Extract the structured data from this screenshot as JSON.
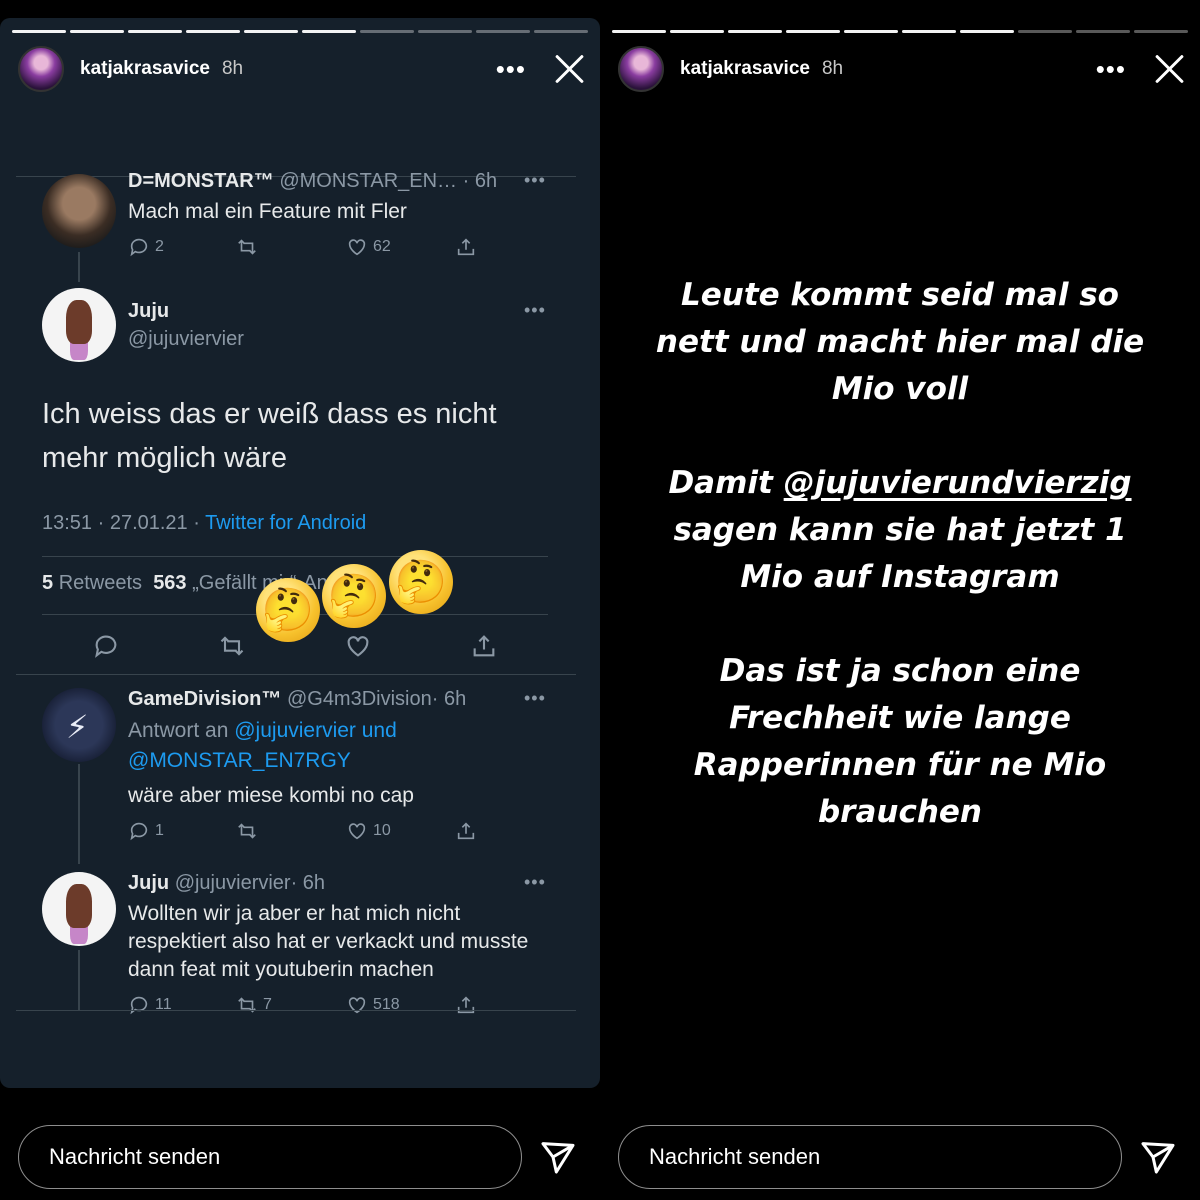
{
  "stories": [
    {
      "username": "katjakrasavice",
      "time": "8h",
      "tweets": {
        "t1": {
          "name": "D=MONSTAR™",
          "handle": "@MONSTAR_EN…",
          "time": "· 6h",
          "text": "Mach mal ein Feature mit Fler",
          "replies": "2",
          "likes": "62"
        },
        "main": {
          "name": "Juju",
          "handle": "@jujuviervier",
          "text": "Ich weiss das er weiß dass es nicht mehr möglich wäre",
          "meta_time": "13:51 · 27.01.21 · ",
          "meta_source": "Twitter for Android",
          "retweets_count": "5",
          "retweets_label": "Retweets",
          "likes_count": "563",
          "likes_label": "„Gefällt mir“-Angaben"
        },
        "t3": {
          "name": "GameDivision™",
          "handle": "@G4m3Division",
          "time": "· 6h",
          "reply_prefix": "Antwort an ",
          "reply_target": "@jujuviervier und @MONSTAR_EN7RGY",
          "text": "wäre aber miese kombi no cap",
          "replies": "1",
          "likes": "10"
        },
        "t4": {
          "name": "Juju",
          "handle": "@jujuviervier",
          "time": "· 6h",
          "text": "Wollten wir ja aber er hat mich nicht respektiert also hat er verkackt und musste dann feat mit youtuberin machen",
          "replies": "11",
          "retweets": "7",
          "likes": "518"
        }
      },
      "emoji": "🤔",
      "message_placeholder": "Nachricht senden"
    },
    {
      "username": "katjakrasavice",
      "time": "8h",
      "text": {
        "p1": "Leute kommt seid mal so nett und macht hier mal die Mio voll",
        "p2_prefix": "Damit ",
        "p2_mention": "@jujuvierundvierzig",
        "p2_suffix": " sagen kann sie hat jetzt 1 Mio auf Instagram",
        "p3": "Das ist ja schon eine Frechheit wie lange Rapperinnen für ne Mio brauchen"
      },
      "message_placeholder": "Nachricht senden"
    }
  ],
  "colors": {
    "tweet_bg": "#15202b",
    "link": "#1d9bf0",
    "story_bg": "#000000"
  }
}
